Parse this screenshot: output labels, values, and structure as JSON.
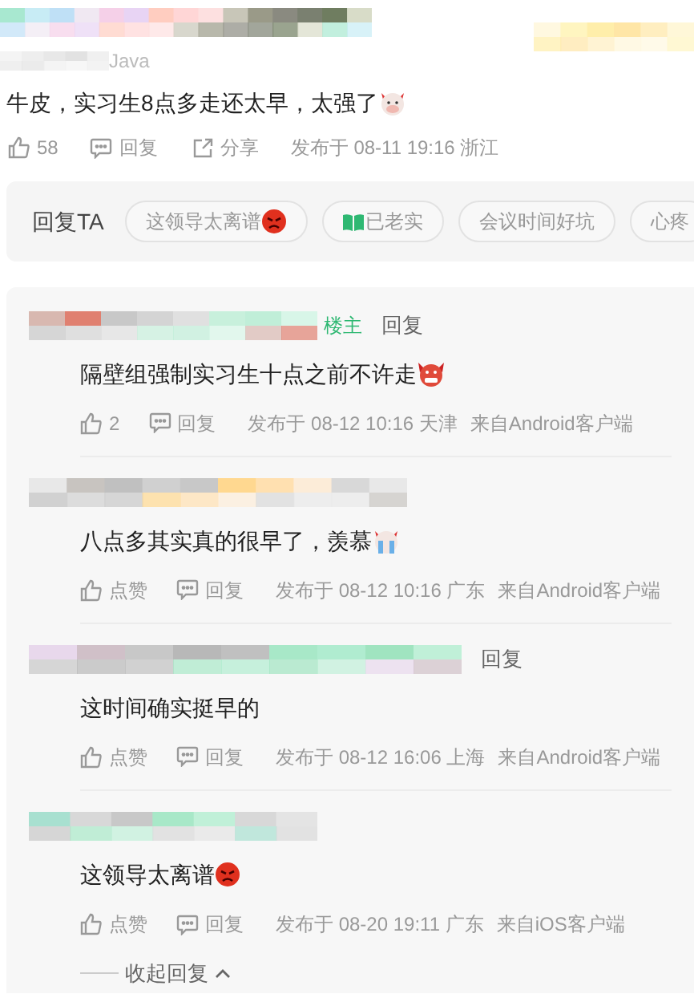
{
  "comment": {
    "author_suffix": "Java",
    "text": "牛皮，实习生8点多走还太早，太强了",
    "emoji": {
      "kind": "ox"
    },
    "likes": "58",
    "reply": "回复",
    "share": "分享",
    "published": "发布于 08-11 19:16 浙江"
  },
  "quick_reply": {
    "label": "回复TA",
    "chips": [
      {
        "text": "这领导太离谱",
        "emoji": {
          "kind": "angry"
        }
      },
      {
        "text": "已老实",
        "emoji": {
          "kind": "book"
        }
      },
      {
        "text": "会议时间好坑"
      },
      {
        "text": "心疼"
      }
    ]
  },
  "replies": [
    {
      "author_tag": "楼主",
      "reply_link": "回复",
      "text": "隔壁组强制实习生十点之前不许走",
      "emoji": {
        "kind": "devil"
      },
      "likes": "2",
      "reply": "回复",
      "published": "发布于 08-12 10:16 天津",
      "source": "来自Android客户端"
    },
    {
      "text": "八点多其实真的很早了，羡慕",
      "emoji": {
        "kind": "crying"
      },
      "likes": "点赞",
      "reply": "回复",
      "published": "发布于 08-12 10:16 广东",
      "source": "来自Android客户端"
    },
    {
      "reply_link": "回复",
      "text": "这时间确实挺早的",
      "likes": "点赞",
      "reply": "回复",
      "published": "发布于 08-12 16:06 上海",
      "source": "来自Android客户端"
    },
    {
      "text": "这领导太离谱",
      "emoji": {
        "kind": "angry"
      },
      "likes": "点赞",
      "reply": "回复",
      "published": "发布于 08-20 19:11 广东",
      "source": "来自iOS客户端"
    }
  ],
  "collapse": "收起回复"
}
